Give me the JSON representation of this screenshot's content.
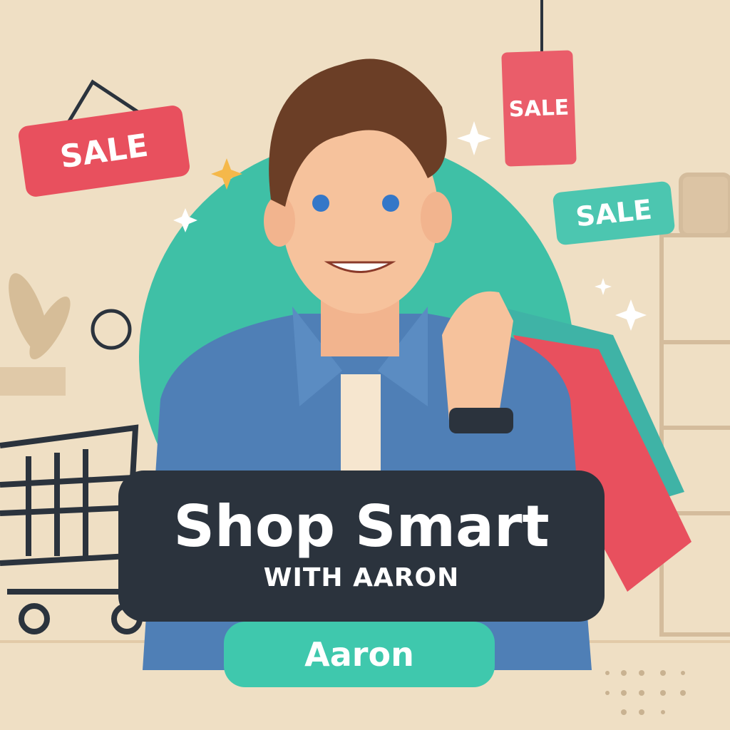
{
  "tags": {
    "sale_left": "SALE",
    "sale_hanging": "SALE",
    "sale_right": "SALE"
  },
  "banner": {
    "title": "Shop Smart",
    "subtitle": "WITH AARON"
  },
  "name_pill": {
    "label": "Aaron"
  },
  "colors": {
    "background": "#efdfc4",
    "sale_red": "#e8505e",
    "teal": "#3fc8ad",
    "banner": "#2b333d",
    "shirt": "#4f7fb6"
  }
}
